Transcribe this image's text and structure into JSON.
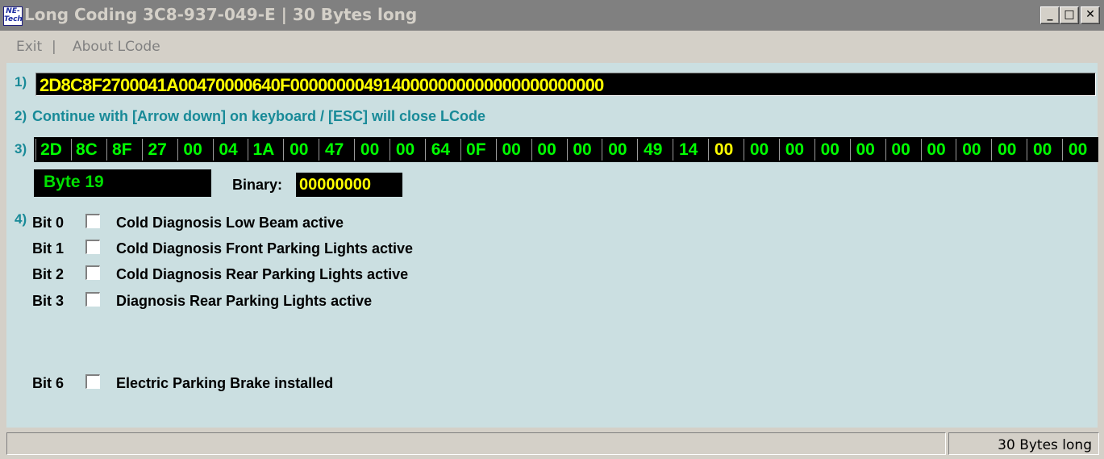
{
  "window": {
    "title": "Long Coding  3C8-937-049-E | 30 Bytes long",
    "icon_text_1": "NE-",
    "icon_text_2": "Tech"
  },
  "title_buttons": {
    "minimize": "_",
    "maximize": "□",
    "close": "✕"
  },
  "menu": {
    "exit": "Exit",
    "separator": "|",
    "about": "About LCode"
  },
  "steps": {
    "s1": "1)",
    "s2": "2)",
    "s3": "3)",
    "s4": "4)"
  },
  "coding_string": "2D8C8F2700041A00470000640F0000000049140000000000000000000000",
  "instruction": "Continue with [Arrow down] on keyboard / [ESC] will close LCode",
  "bytes": [
    "2D",
    "8C",
    "8F",
    "27",
    "00",
    "04",
    "1A",
    "00",
    "47",
    "00",
    "00",
    "64",
    "0F",
    "00",
    "00",
    "00",
    "00",
    "49",
    "14",
    "00",
    "00",
    "00",
    "00",
    "00",
    "00",
    "00",
    "00",
    "00",
    "00",
    "00"
  ],
  "selected_byte_index": 19,
  "byte_label": "Byte 19",
  "binary_label": "Binary:",
  "binary_value": "00000000",
  "bits": [
    {
      "name": "Bit 0",
      "label": "Cold Diagnosis Low Beam active",
      "checked": false
    },
    {
      "name": "Bit 1",
      "label": "Cold Diagnosis Front Parking Lights active",
      "checked": false
    },
    {
      "name": "Bit 2",
      "label": "Cold Diagnosis Rear Parking Lights active",
      "checked": false
    },
    {
      "name": "Bit 3",
      "label": "Diagnosis Rear Parking Lights active",
      "checked": false
    },
    {
      "name": "Bit 6",
      "label": "Electric Parking Brake installed",
      "checked": false
    }
  ],
  "status": {
    "text": "30 Bytes long"
  },
  "colors": {
    "client_bg": "#cbdfe1",
    "accent_text": "#188a98",
    "byte_green": "#00ff00",
    "byte_selected": "#ffff00"
  }
}
